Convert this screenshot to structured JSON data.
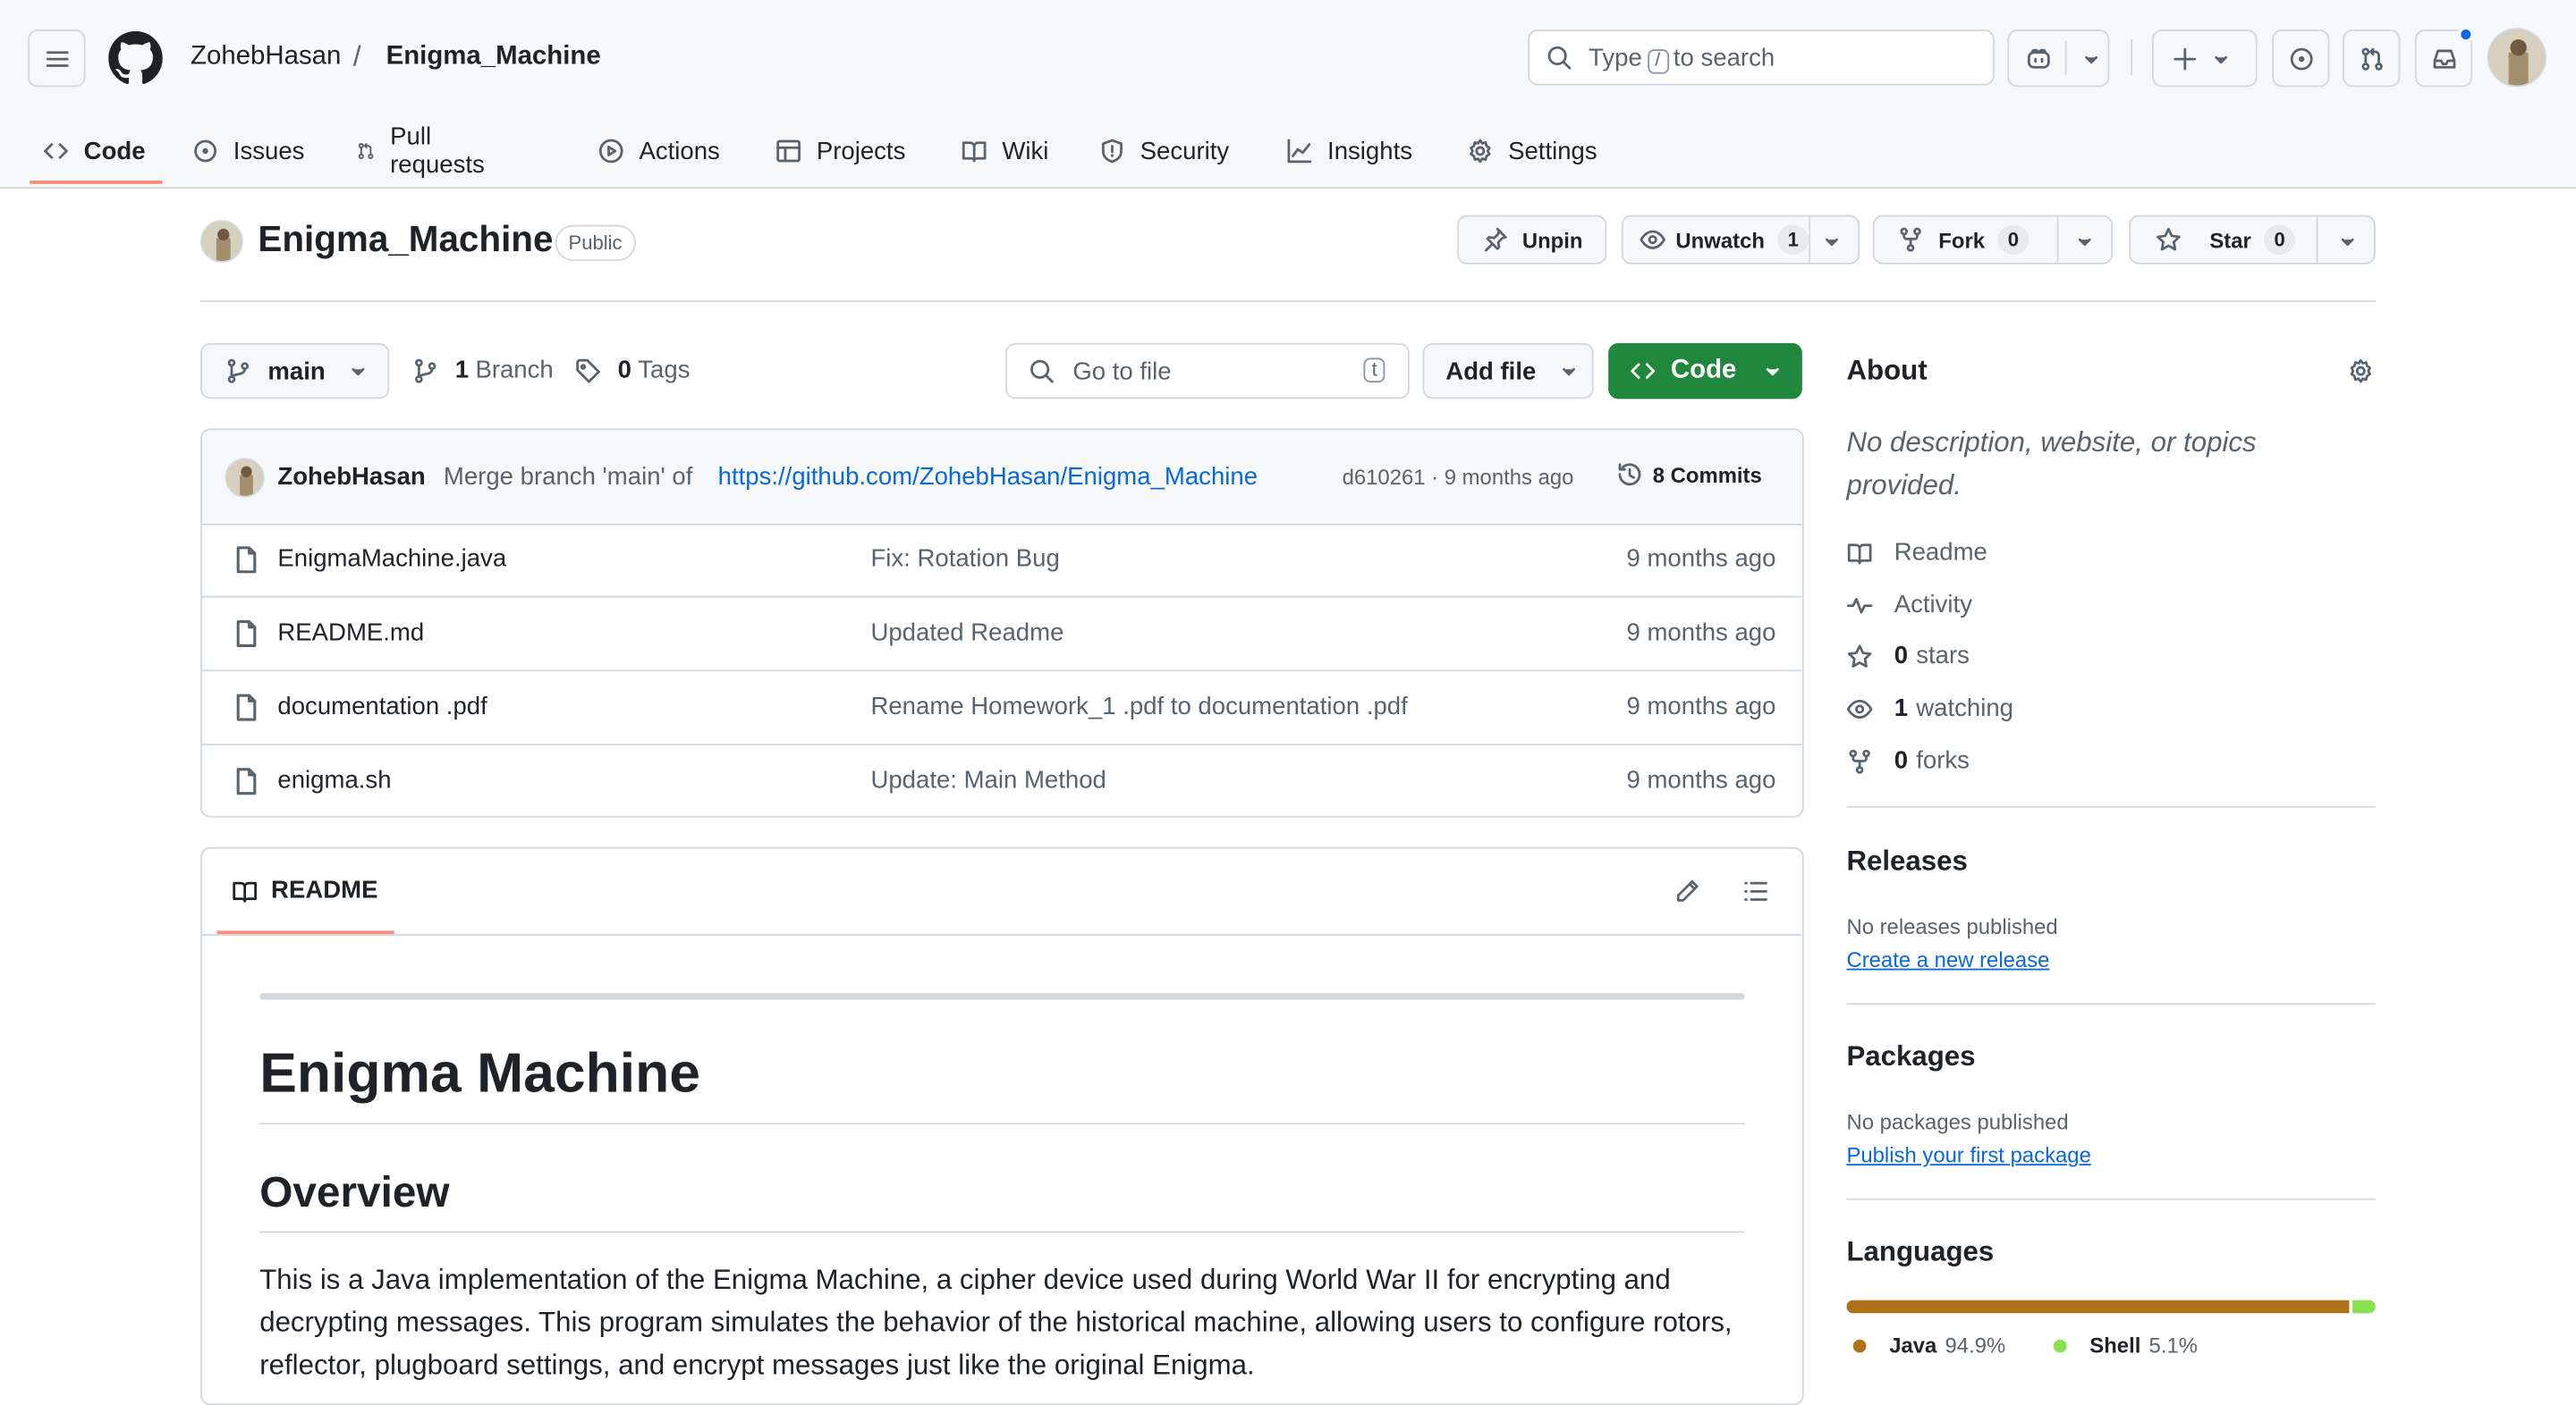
{
  "header": {
    "owner": "ZohebHasan",
    "separator": "/",
    "repo": "Enigma_Machine",
    "search_prefix": "Type",
    "search_key": "/",
    "search_suffix": "to search"
  },
  "tabs": {
    "code": "Code",
    "issues": "Issues",
    "pulls": "Pull requests",
    "actions": "Actions",
    "projects": "Projects",
    "wiki": "Wiki",
    "security": "Security",
    "insights": "Insights",
    "settings": "Settings"
  },
  "repo": {
    "name": "Enigma_Machine",
    "visibility": "Public",
    "unpin_label": "Unpin",
    "unwatch_label": "Unwatch",
    "unwatch_count": "1",
    "fork_label": "Fork",
    "fork_count": "0",
    "star_label": "Star",
    "star_count": "0"
  },
  "branchbar": {
    "branch": "main",
    "branches_count": "1",
    "branches_label": "Branch",
    "tags_count": "0",
    "tags_label": "Tags",
    "goto_placeholder": "Go to file",
    "goto_key": "t",
    "add_file": "Add file",
    "code_button": "Code"
  },
  "commit": {
    "author": "ZohebHasan",
    "message": "Merge branch 'main' of",
    "link": "https://github.com/ZohebHasan/Enigma_Machine",
    "meta": "d610261 · 9 months ago",
    "commits_label": "8 Commits"
  },
  "files": [
    {
      "name": "EnigmaMachine.java",
      "message": "Fix: Rotation Bug",
      "age": "9 months ago"
    },
    {
      "name": "README.md",
      "message": "Updated Readme",
      "age": "9 months ago"
    },
    {
      "name": "documentation .pdf",
      "message": "Rename Homework_1 .pdf to documentation .pdf",
      "age": "9 months ago"
    },
    {
      "name": "enigma.sh",
      "message": "Update: Main Method",
      "age": "9 months ago"
    }
  ],
  "readme": {
    "tab": "README",
    "h1": "Enigma Machine",
    "h2": "Overview",
    "paragraph": "This is a Java implementation of the Enigma Machine, a cipher device used during World War II for encrypting and decrypting messages. This program simulates the behavior of the historical machine, allowing users to configure rotors, reflector, plugboard settings, and encrypt messages just like the original Enigma."
  },
  "about": {
    "title": "About",
    "description": "No description, website, or topics provided.",
    "readme": "Readme",
    "activity": "Activity",
    "stars_count": "0",
    "stars_label": "stars",
    "watching_count": "1",
    "watching_label": "watching",
    "forks_count": "0",
    "forks_label": "forks"
  },
  "releases": {
    "title": "Releases",
    "empty": "No releases published",
    "link": "Create a new release"
  },
  "packages": {
    "title": "Packages",
    "empty": "No packages published",
    "link": "Publish your first package"
  },
  "languages": {
    "title": "Languages",
    "items": [
      {
        "name": "Java",
        "percent": "94.9%",
        "value": 94.9,
        "color": "#b07219"
      },
      {
        "name": "Shell",
        "percent": "5.1%",
        "value": 5.1,
        "color": "#89e051"
      }
    ]
  },
  "colors": {
    "accent_green": "#1f883d",
    "link_blue": "#0969da",
    "tab_underline": "#fd8c73",
    "notification_dot": "#0969da"
  }
}
